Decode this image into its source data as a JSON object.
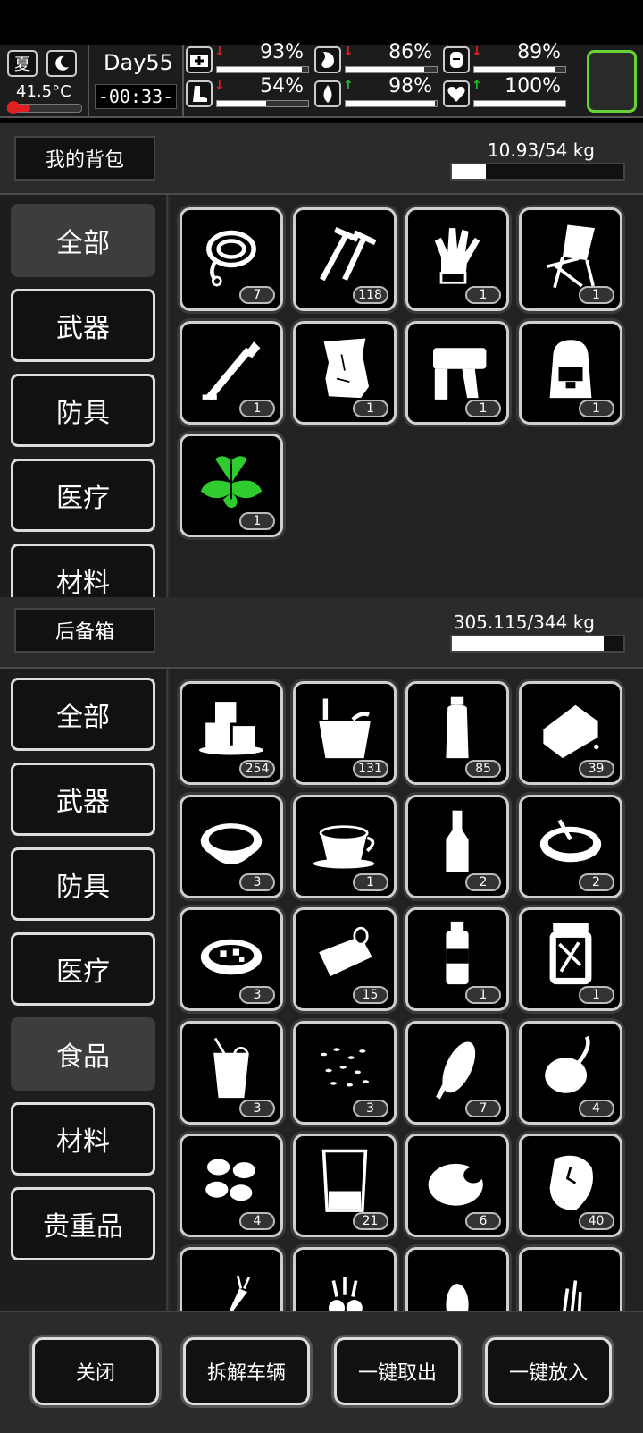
{
  "status": {
    "season": "夏",
    "temperature": "41.5°C",
    "day": "Day55",
    "time": "-00:33-",
    "stats": [
      {
        "icon": "medkit-icon",
        "value": "93%",
        "level": 0.93,
        "trend": "down"
      },
      {
        "icon": "stomach-icon",
        "value": "86%",
        "level": 0.86,
        "trend": "down"
      },
      {
        "icon": "stamina-icon",
        "value": "89%",
        "level": 0.89,
        "trend": "down"
      },
      {
        "icon": "boot-icon",
        "value": "54%",
        "level": 0.54,
        "trend": "down"
      },
      {
        "icon": "water-drop-icon",
        "value": "98%",
        "level": 0.98,
        "trend": "up"
      },
      {
        "icon": "heart-icon",
        "value": "100%",
        "level": 1.0,
        "trend": "up"
      }
    ]
  },
  "backpack": {
    "title": "我的背包",
    "weight": "10.93/54 kg",
    "weight_level": 0.2,
    "categories": [
      "全部",
      "武器",
      "防具",
      "医疗",
      "材料"
    ],
    "active_category": "全部",
    "items": [
      {
        "icon": "rope-icon",
        "count": "7"
      },
      {
        "icon": "nails-icon",
        "count": "118"
      },
      {
        "icon": "gloves-icon",
        "count": "1"
      },
      {
        "icon": "folding-chair-icon",
        "count": "1"
      },
      {
        "icon": "pump-icon",
        "count": "1"
      },
      {
        "icon": "paper-scrap-icon",
        "count": "1"
      },
      {
        "icon": "nail-gun-icon",
        "count": "1"
      },
      {
        "icon": "backpack-icon",
        "count": "1"
      },
      {
        "icon": "herb-leaves-icon",
        "count": "1"
      }
    ]
  },
  "storage": {
    "title": "后备箱",
    "weight": "305.115/344 kg",
    "weight_level": 0.887,
    "categories": [
      "全部",
      "武器",
      "防具",
      "医疗",
      "食品",
      "材料",
      "贵重品"
    ],
    "active_category": "食品",
    "items": [
      {
        "icon": "ice-cubes-icon",
        "count": "254"
      },
      {
        "icon": "water-bucket-icon",
        "count": "131"
      },
      {
        "icon": "water-bottle-icon",
        "count": "85"
      },
      {
        "icon": "bread-icon",
        "count": "39"
      },
      {
        "icon": "soup-bowl-icon",
        "count": "3"
      },
      {
        "icon": "coffee-cup-icon",
        "count": "1"
      },
      {
        "icon": "liquor-bottle-icon",
        "count": "2"
      },
      {
        "icon": "stew-pot-icon",
        "count": "2"
      },
      {
        "icon": "vegetable-soup-icon",
        "count": "3"
      },
      {
        "icon": "canned-fish-icon",
        "count": "15"
      },
      {
        "icon": "drink-bottle-icon",
        "count": "1"
      },
      {
        "icon": "pickle-jar-icon",
        "count": "1"
      },
      {
        "icon": "juice-glass-icon",
        "count": "3"
      },
      {
        "icon": "seeds-icon",
        "count": "3"
      },
      {
        "icon": "corn-icon",
        "count": "7"
      },
      {
        "icon": "sweet-potato-icon",
        "count": "4"
      },
      {
        "icon": "potatoes-icon",
        "count": "4"
      },
      {
        "icon": "beaker-icon",
        "count": "21"
      },
      {
        "icon": "raw-meat-icon",
        "count": "6"
      },
      {
        "icon": "steak-icon",
        "count": "40"
      },
      {
        "icon": "carrot-icon",
        "count": ""
      },
      {
        "icon": "radishes-icon",
        "count": ""
      },
      {
        "icon": "peanut-icon",
        "count": ""
      },
      {
        "icon": "grass-icon",
        "count": ""
      }
    ]
  },
  "bottom": {
    "close": "关闭",
    "dismantle": "拆解车辆",
    "take_all": "一键取出",
    "put_all": "一键放入"
  },
  "colors": {
    "accent_green": "#66d236",
    "herb_green": "#2ecc2e",
    "down_red": "#e02020",
    "up_green": "#22c022"
  }
}
